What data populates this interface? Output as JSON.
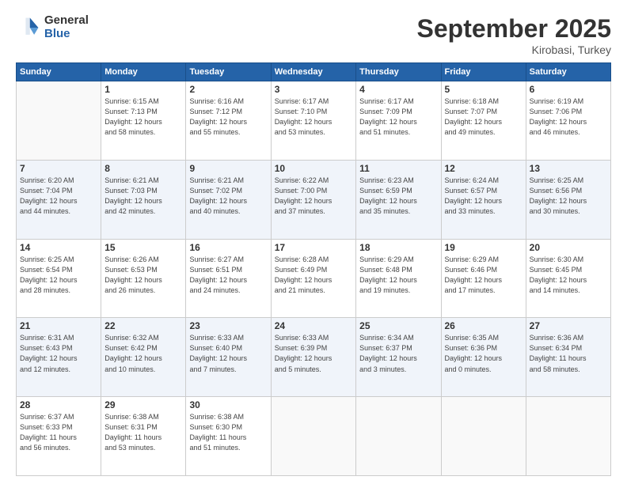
{
  "logo": {
    "general": "General",
    "blue": "Blue"
  },
  "title": "September 2025",
  "location": "Kirobasi, Turkey",
  "days_of_week": [
    "Sunday",
    "Monday",
    "Tuesday",
    "Wednesday",
    "Thursday",
    "Friday",
    "Saturday"
  ],
  "weeks": [
    [
      {
        "day": "",
        "info": ""
      },
      {
        "day": "1",
        "info": "Sunrise: 6:15 AM\nSunset: 7:13 PM\nDaylight: 12 hours\nand 58 minutes."
      },
      {
        "day": "2",
        "info": "Sunrise: 6:16 AM\nSunset: 7:12 PM\nDaylight: 12 hours\nand 55 minutes."
      },
      {
        "day": "3",
        "info": "Sunrise: 6:17 AM\nSunset: 7:10 PM\nDaylight: 12 hours\nand 53 minutes."
      },
      {
        "day": "4",
        "info": "Sunrise: 6:17 AM\nSunset: 7:09 PM\nDaylight: 12 hours\nand 51 minutes."
      },
      {
        "day": "5",
        "info": "Sunrise: 6:18 AM\nSunset: 7:07 PM\nDaylight: 12 hours\nand 49 minutes."
      },
      {
        "day": "6",
        "info": "Sunrise: 6:19 AM\nSunset: 7:06 PM\nDaylight: 12 hours\nand 46 minutes."
      }
    ],
    [
      {
        "day": "7",
        "info": "Sunrise: 6:20 AM\nSunset: 7:04 PM\nDaylight: 12 hours\nand 44 minutes."
      },
      {
        "day": "8",
        "info": "Sunrise: 6:21 AM\nSunset: 7:03 PM\nDaylight: 12 hours\nand 42 minutes."
      },
      {
        "day": "9",
        "info": "Sunrise: 6:21 AM\nSunset: 7:02 PM\nDaylight: 12 hours\nand 40 minutes."
      },
      {
        "day": "10",
        "info": "Sunrise: 6:22 AM\nSunset: 7:00 PM\nDaylight: 12 hours\nand 37 minutes."
      },
      {
        "day": "11",
        "info": "Sunrise: 6:23 AM\nSunset: 6:59 PM\nDaylight: 12 hours\nand 35 minutes."
      },
      {
        "day": "12",
        "info": "Sunrise: 6:24 AM\nSunset: 6:57 PM\nDaylight: 12 hours\nand 33 minutes."
      },
      {
        "day": "13",
        "info": "Sunrise: 6:25 AM\nSunset: 6:56 PM\nDaylight: 12 hours\nand 30 minutes."
      }
    ],
    [
      {
        "day": "14",
        "info": "Sunrise: 6:25 AM\nSunset: 6:54 PM\nDaylight: 12 hours\nand 28 minutes."
      },
      {
        "day": "15",
        "info": "Sunrise: 6:26 AM\nSunset: 6:53 PM\nDaylight: 12 hours\nand 26 minutes."
      },
      {
        "day": "16",
        "info": "Sunrise: 6:27 AM\nSunset: 6:51 PM\nDaylight: 12 hours\nand 24 minutes."
      },
      {
        "day": "17",
        "info": "Sunrise: 6:28 AM\nSunset: 6:49 PM\nDaylight: 12 hours\nand 21 minutes."
      },
      {
        "day": "18",
        "info": "Sunrise: 6:29 AM\nSunset: 6:48 PM\nDaylight: 12 hours\nand 19 minutes."
      },
      {
        "day": "19",
        "info": "Sunrise: 6:29 AM\nSunset: 6:46 PM\nDaylight: 12 hours\nand 17 minutes."
      },
      {
        "day": "20",
        "info": "Sunrise: 6:30 AM\nSunset: 6:45 PM\nDaylight: 12 hours\nand 14 minutes."
      }
    ],
    [
      {
        "day": "21",
        "info": "Sunrise: 6:31 AM\nSunset: 6:43 PM\nDaylight: 12 hours\nand 12 minutes."
      },
      {
        "day": "22",
        "info": "Sunrise: 6:32 AM\nSunset: 6:42 PM\nDaylight: 12 hours\nand 10 minutes."
      },
      {
        "day": "23",
        "info": "Sunrise: 6:33 AM\nSunset: 6:40 PM\nDaylight: 12 hours\nand 7 minutes."
      },
      {
        "day": "24",
        "info": "Sunrise: 6:33 AM\nSunset: 6:39 PM\nDaylight: 12 hours\nand 5 minutes."
      },
      {
        "day": "25",
        "info": "Sunrise: 6:34 AM\nSunset: 6:37 PM\nDaylight: 12 hours\nand 3 minutes."
      },
      {
        "day": "26",
        "info": "Sunrise: 6:35 AM\nSunset: 6:36 PM\nDaylight: 12 hours\nand 0 minutes."
      },
      {
        "day": "27",
        "info": "Sunrise: 6:36 AM\nSunset: 6:34 PM\nDaylight: 11 hours\nand 58 minutes."
      }
    ],
    [
      {
        "day": "28",
        "info": "Sunrise: 6:37 AM\nSunset: 6:33 PM\nDaylight: 11 hours\nand 56 minutes."
      },
      {
        "day": "29",
        "info": "Sunrise: 6:38 AM\nSunset: 6:31 PM\nDaylight: 11 hours\nand 53 minutes."
      },
      {
        "day": "30",
        "info": "Sunrise: 6:38 AM\nSunset: 6:30 PM\nDaylight: 11 hours\nand 51 minutes."
      },
      {
        "day": "",
        "info": ""
      },
      {
        "day": "",
        "info": ""
      },
      {
        "day": "",
        "info": ""
      },
      {
        "day": "",
        "info": ""
      }
    ]
  ]
}
